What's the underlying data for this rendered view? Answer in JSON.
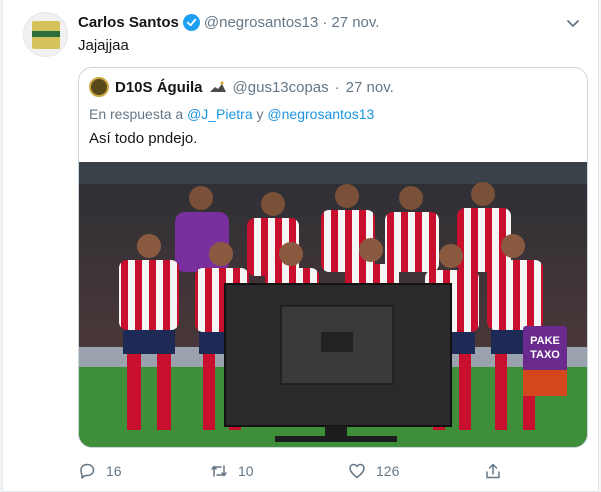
{
  "tweet": {
    "author_name": "Carlos Santos",
    "handle": "@negrosantos13",
    "separator": "·",
    "date": "27 nov.",
    "text": "Jajajjaa"
  },
  "quoted": {
    "author_name": "D10S Águila",
    "handle": "@gus13copas",
    "separator": "·",
    "date": "27 nov.",
    "reply_prefix": "En respuesta a",
    "reply_user1": "@J_Pietra",
    "reply_joiner": "y",
    "reply_user2": "@negrosantos13",
    "text": "Así todo pndejo."
  },
  "photo": {
    "bag_line1": "PAKE",
    "bag_line2": "TAXO"
  },
  "actions": {
    "replies": "16",
    "retweets": "10",
    "likes": "126"
  },
  "colors": {
    "accent": "#1da1f2",
    "link": "#1b95e0",
    "muted": "#657786",
    "jersey_red": "#c8102e"
  },
  "icons": [
    "verified-icon",
    "chevron-down-icon",
    "reply-icon",
    "retweet-icon",
    "like-icon",
    "share-icon"
  ]
}
